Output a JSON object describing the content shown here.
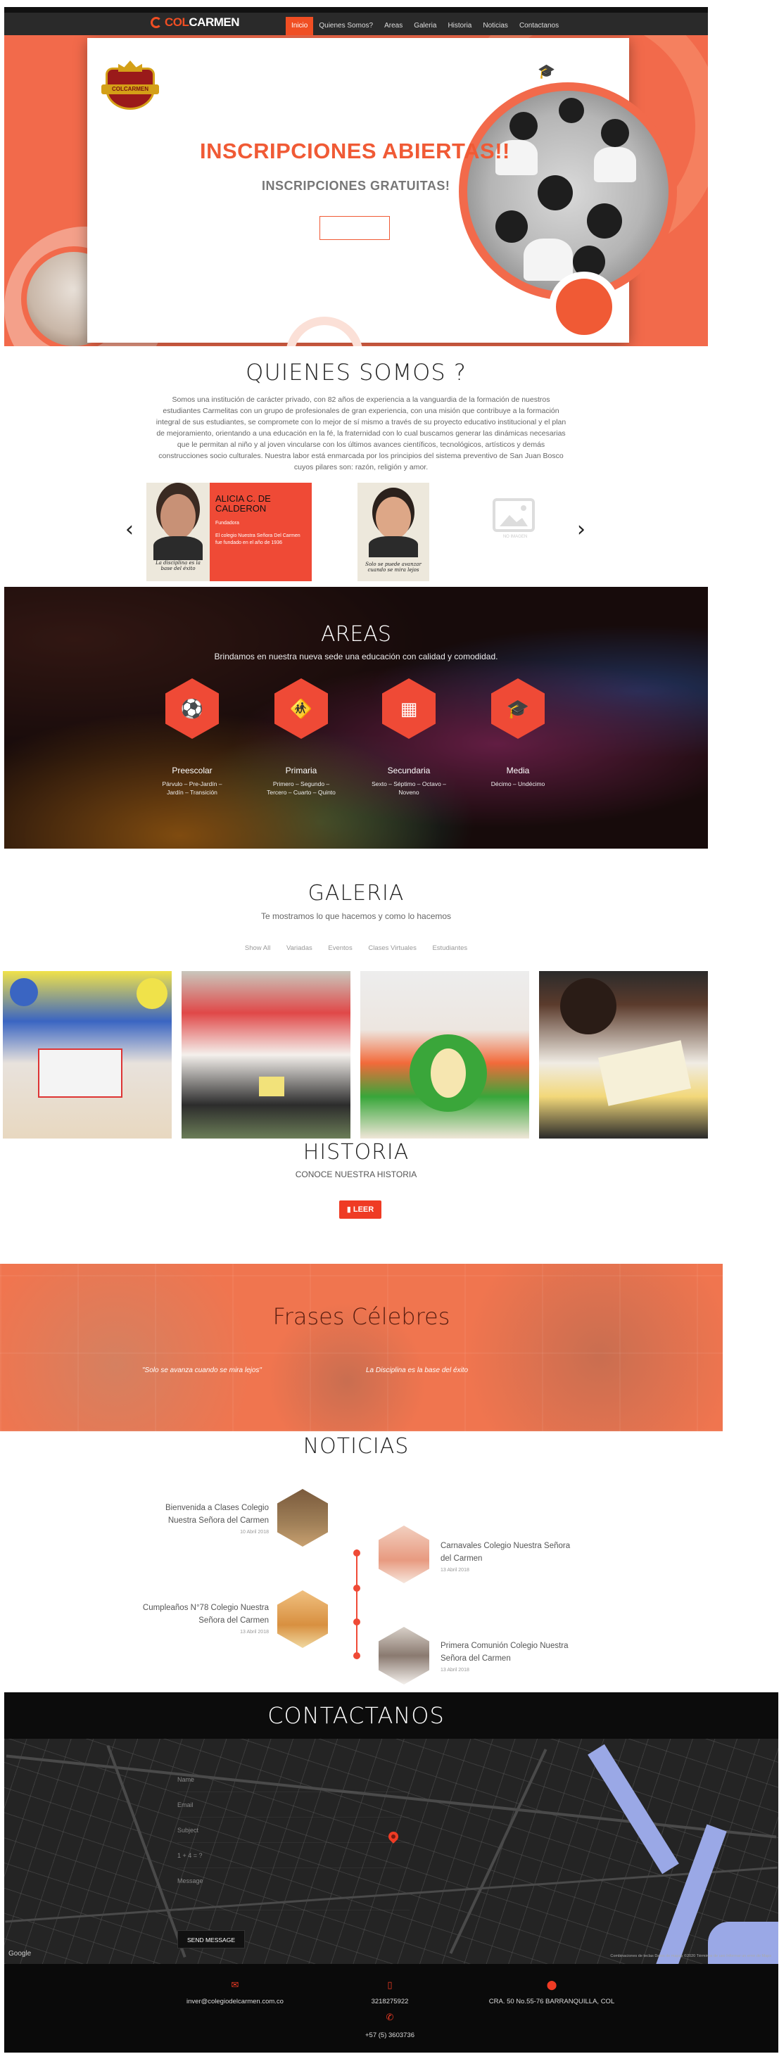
{
  "nav": {
    "brand_prefix": "COL",
    "brand_accent": "CARMEN",
    "links": [
      "Inicio",
      "Quienes Somos?",
      "Areas",
      "Galeria",
      "Historia",
      "Noticias",
      "Contactanos"
    ]
  },
  "hero": {
    "crest_text": "COLCARMEN",
    "title": "INSCRIPCIONES ABIERTAS!!",
    "subtitle": "INSCRIPCIONES GRATUITAS!"
  },
  "quienes": {
    "title": "QUIENES SOMOS ?",
    "text": "Somos una institución de carácter privado, con 82 años de experiencia a la vanguardia de la formación de nuestros estudiantes Carmelitas con un grupo de profesionales de gran experiencia, con una misión que contribuye a la formación integral de sus estudiantes, se compromete con lo mejor de sí mismo a través de su proyecto educativo institucional y el plan de mejoramiento, orientando a una educación en la fé, la fraternidad con lo cual buscamos generar las dinámicas necesarias que le permitan al niño y al joven vincularse con los últimos avances científicos, tecnológicos, artísticos y demás construcciones socio culturales. Nuestra labor está enmarcada por los principios del sistema preventivo de San Juan Bosco cuyos pilares son: razón, religión y amor.",
    "slides": [
      {
        "name": "ALICIA C. DE CALDERON",
        "role": "Fundadora",
        "desc": "El colegio Nuestra Señora Del Carmen fue fundado en el año de 1936",
        "quote": "La disciplina es la base del éxito"
      },
      {
        "quote": "Solo se puede avanzar cuando se mira lejos"
      },
      {
        "label": "NO IMAGEN"
      }
    ]
  },
  "areas": {
    "title": "AREAS",
    "subtitle": "Brindamos en nuestra nueva sede una educación con calidad y comodidad.",
    "items": [
      {
        "name": "Preescolar",
        "desc": "Párvulo – Pre-Jardín – Jardín – Transición",
        "icon": "soccer-ball-icon"
      },
      {
        "name": "Primaria",
        "desc": "Primero – Segundo – Tercero – Cuarto – Quinto",
        "icon": "child-icon"
      },
      {
        "name": "Secundaria",
        "desc": "Sexto – Séptimo – Octavo – Noveno",
        "icon": "building-icon"
      },
      {
        "name": "Media",
        "desc": "Décimo – Undécimo",
        "icon": "graduation-cap-icon"
      }
    ]
  },
  "galeria": {
    "title": "GALERIA",
    "subtitle": "Te mostramos lo que hacemos y como lo hacemos",
    "filters": [
      "Show All",
      "Variadas",
      "Eventos",
      "Clases Virtuales",
      "Estudiantes"
    ]
  },
  "historia": {
    "title": "HISTORIA",
    "subtitle": "CONOCE NUESTRA HISTORIA",
    "button": "LEER"
  },
  "frases": {
    "title": "Frases Célebres",
    "items": [
      "\"Solo se avanza cuando se mira lejos\"",
      "La Disciplina es la base del éxito"
    ]
  },
  "noticias": {
    "title": "NOTICIAS",
    "items": [
      {
        "title": "Bienvenida a Clases Colegio Nuestra Señora del Carmen",
        "date": "10 Abril 2018"
      },
      {
        "title": "Carnavales Colegio Nuestra Señora del Carmen",
        "date": "13 Abril 2018"
      },
      {
        "title": "Cumpleaños N°78 Colegio Nuestra Señora del Carmen",
        "date": "13 Abril 2018"
      },
      {
        "title": "Primera Comunión Colegio Nuestra Señora del Carmen",
        "date": "13 Abril 2018"
      }
    ]
  },
  "contact": {
    "title": "CONTACTANOS",
    "fields": [
      "Name",
      "Email",
      "Subject",
      "1 + 4 = ?",
      "Message"
    ],
    "send": "SEND MESSAGE",
    "google": "Google",
    "map_terms": "Combinaciones de teclas   Datos de mapas ©2020   Términos de uso   Informar un error de Maps",
    "email": "inver@colegiodelcarmen.com.co",
    "phone": "3218275922",
    "phone2": "+57 (5) 3603736",
    "address": "CRA. 50 No.55-76 BARRANQUILLA, COL"
  }
}
